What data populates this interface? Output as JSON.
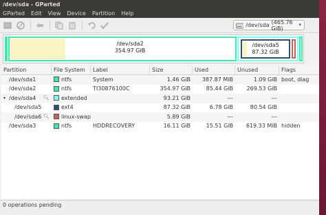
{
  "window": {
    "title": "/dev/sda - GParted"
  },
  "menu": [
    "GParted",
    "Edit",
    "View",
    "Device",
    "Partition",
    "Help"
  ],
  "toolbar": {
    "buttons": [
      "new-icon",
      "delete-icon",
      "resize-icon",
      "copy-icon",
      "paste-icon",
      "undo-icon",
      "apply-icon"
    ],
    "device": "/dev/sda",
    "device_size": "(465.76 GiB)"
  },
  "graph": {
    "sda2_name": "/dev/sda2",
    "sda2_size": "354.97 GiB",
    "sda5_name": "/dev/sda5",
    "sda5_size": "87.32 GiB"
  },
  "columns": [
    "Partition",
    "File System",
    "Label",
    "Size",
    "Used",
    "Unused",
    "Flags"
  ],
  "rows": [
    {
      "partition": "/dev/sda1",
      "fs": "ntfs",
      "fs_color": "#42e5ac",
      "label": "System",
      "size": "1.46 GiB",
      "used": "387.87 MiB",
      "unused": "1.09 GiB",
      "flags": "boot, diag"
    },
    {
      "partition": "/dev/sda2",
      "fs": "ntfs",
      "fs_color": "#42e5ac",
      "label": "TI30876100C",
      "size": "354.97 GiB",
      "used": "85.44 GiB",
      "unused": "269.53 GiB",
      "flags": ""
    },
    {
      "partition": "/dev/sda4",
      "fs": "extended",
      "fs_color": "#7dfcfe",
      "label": "",
      "size": "93.21 GiB",
      "used": "---",
      "unused": "---",
      "flags": ""
    },
    {
      "partition": "/dev/sda5",
      "fs": "ext4",
      "fs_color": "#314e6c",
      "label": "",
      "size": "87.32 GiB",
      "used": "6.78 GiB",
      "unused": "80.54 GiB",
      "flags": ""
    },
    {
      "partition": "/dev/sda6",
      "fs": "linux-swap",
      "fs_color": "#c1665a",
      "label": "",
      "size": "5.89 GiB",
      "used": "---",
      "unused": "---",
      "flags": ""
    },
    {
      "partition": "/dev/sda3",
      "fs": "ntfs",
      "fs_color": "#42e5ac",
      "label": "HDDRECOVERY",
      "size": "16.11 GiB",
      "used": "15.51 GiB",
      "unused": "619.33 MiB",
      "flags": "hidden"
    }
  ],
  "status": "0 operations pending"
}
